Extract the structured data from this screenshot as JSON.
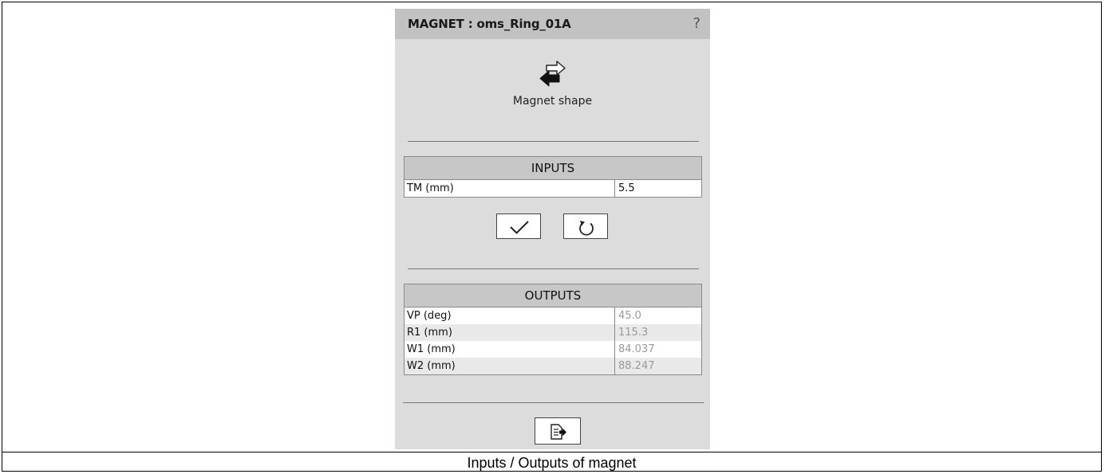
{
  "panel": {
    "title": "MAGNET : oms_Ring_01A",
    "help": "?",
    "shape_label": "Magnet shape"
  },
  "inputs": {
    "header": "INPUTS",
    "rows": [
      {
        "label": "TM (mm)",
        "value": "5.5"
      }
    ]
  },
  "outputs": {
    "header": "OUTPUTS",
    "rows": [
      {
        "label": "VP (deg)",
        "value": "45.0"
      },
      {
        "label": "R1 (mm)",
        "value": "115.3"
      },
      {
        "label": "W1 (mm)",
        "value": "84.037"
      },
      {
        "label": "W2 (mm)",
        "value": "88.247"
      }
    ]
  },
  "caption": "Inputs / Outputs of magnet",
  "icons": {
    "shape": "swap-arrows-icon",
    "validate": "checkmark-icon",
    "reset": "refresh-icon",
    "export": "export-document-icon",
    "help": "question-mark-icon"
  },
  "colors": {
    "panel_bg": "#dcdcdc",
    "header_bg": "#c2c2c2",
    "output_value": "#9a9a9a"
  }
}
